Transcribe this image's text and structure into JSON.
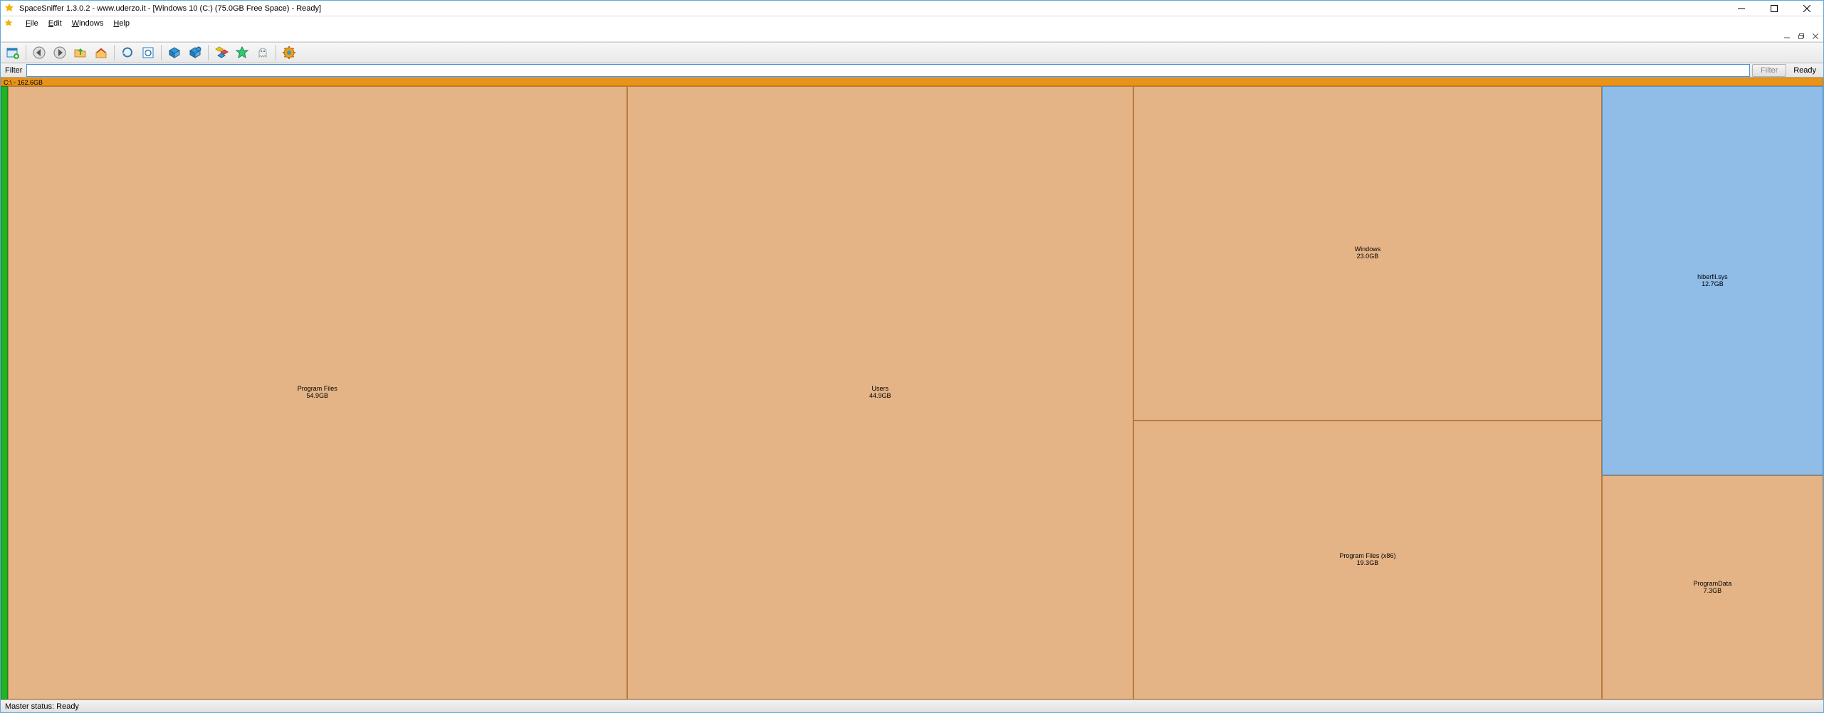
{
  "title": "SpaceSniffer 1.3.0.2 - www.uderzo.it - [Windows 10 (C:) (75.0GB Free Space) - Ready]",
  "menu": {
    "file": "File",
    "edit": "Edit",
    "windows": "Windows",
    "help": "Help"
  },
  "filter": {
    "label": "Filter",
    "value": "",
    "button": "Filter",
    "ready": "Ready"
  },
  "drive": {
    "header": "C:\\ - 162.6GB"
  },
  "cells": {
    "program_files": {
      "name": "Program Files",
      "size": "54.9GB"
    },
    "users": {
      "name": "Users",
      "size": "44.9GB"
    },
    "windows": {
      "name": "Windows",
      "size": "23.0GB"
    },
    "program_files_x86": {
      "name": "Program Files (x86)",
      "size": "19.3GB"
    },
    "hiberfil": {
      "name": "hiberfil.sys",
      "size": "12.7GB"
    },
    "programdata": {
      "name": "ProgramData",
      "size": "7.3GB"
    }
  },
  "status": "Master status: Ready"
}
